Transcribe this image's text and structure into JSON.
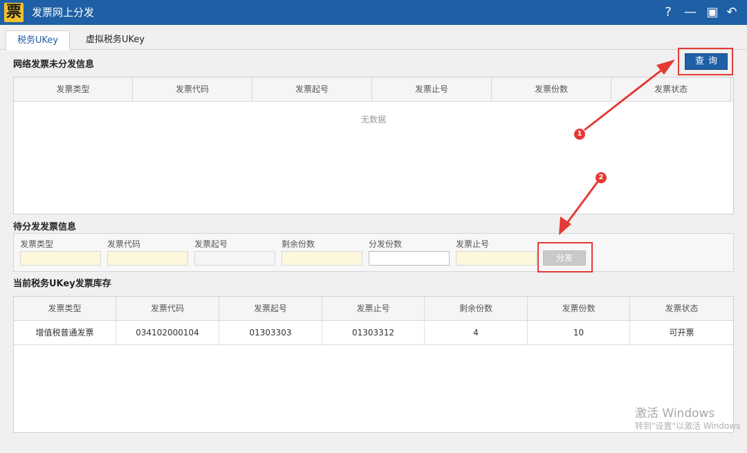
{
  "window": {
    "logo_char": "票",
    "title": "发票网上分发",
    "help": "?",
    "minimize": "—",
    "maximize": "▣",
    "back": "↶"
  },
  "tabs": [
    {
      "label": "税务UKey",
      "active": true
    },
    {
      "label": "虚拟税务UKey",
      "active": false
    }
  ],
  "unissued": {
    "title": "网络发票未分发信息",
    "query_label": "查询",
    "columns": [
      "发票类型",
      "发票代码",
      "发票起号",
      "发票止号",
      "发票份数",
      "发票状态"
    ],
    "empty_text": "无数据"
  },
  "pending": {
    "title": "待分发发票信息",
    "fields": [
      {
        "label": "发票类型",
        "value": ""
      },
      {
        "label": "发票代码",
        "value": ""
      },
      {
        "label": "发票起号",
        "value": ""
      },
      {
        "label": "剩余份数",
        "value": ""
      },
      {
        "label": "分发份数",
        "value": ""
      },
      {
        "label": "发票止号",
        "value": ""
      }
    ],
    "distribute_label": "分发"
  },
  "inventory": {
    "title": "当前税务UKey发票库存",
    "columns": [
      "发票类型",
      "发票代码",
      "发票起号",
      "发票止号",
      "剩余份数",
      "发票份数",
      "发票状态"
    ],
    "rows": [
      [
        "增值税普通发票",
        "034102000104",
        "01303303",
        "01303312",
        "4",
        "10",
        "可开票"
      ]
    ]
  },
  "annotations": {
    "marker1": "1",
    "marker2": "2",
    "color": "#e53935"
  },
  "watermark": {
    "line1": "激活 Windows",
    "line2": "转到\"设置\"以激活 Windows"
  }
}
